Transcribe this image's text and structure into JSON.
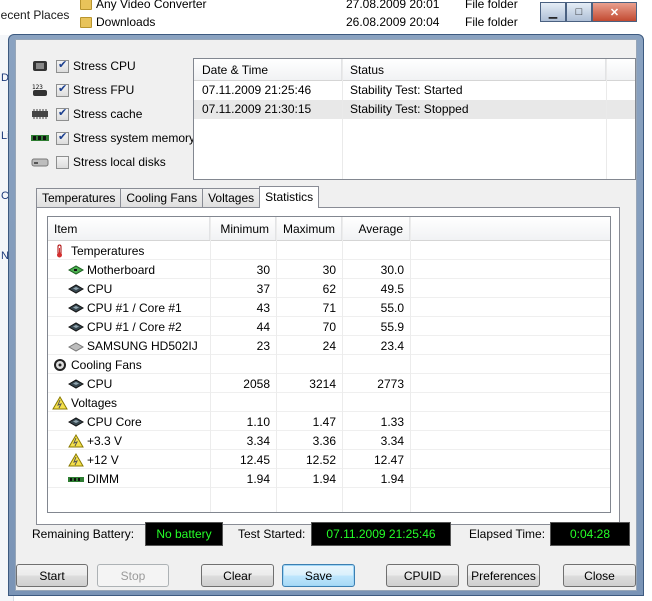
{
  "background_explorer": {
    "nav_label": "Recent Places",
    "side_fragments": [
      "D",
      "Li",
      "Co",
      "N"
    ],
    "files": [
      {
        "name": "Any Video Converter",
        "date": "27.08.2009 20:01",
        "type": "File folder"
      },
      {
        "name": "Downloads",
        "date": "26.08.2009 20:04",
        "type": "File folder"
      }
    ]
  },
  "window_controls": {
    "minimize": "▁",
    "maximize": "□",
    "close": "✕"
  },
  "stress_options": [
    {
      "label": "Stress CPU",
      "checked": true,
      "icon": "cpu-icon"
    },
    {
      "label": "Stress FPU",
      "checked": true,
      "icon": "fpu-icon"
    },
    {
      "label": "Stress cache",
      "checked": true,
      "icon": "cache-icon"
    },
    {
      "label": "Stress system memory",
      "checked": true,
      "icon": "memory-icon"
    },
    {
      "label": "Stress local disks",
      "checked": false,
      "icon": "disk-icon"
    }
  ],
  "status_log": {
    "headers": [
      "Date & Time",
      "Status"
    ],
    "rows": [
      {
        "datetime": "07.11.2009 21:25:46",
        "status": "Stability Test: Started"
      },
      {
        "datetime": "07.11.2009 21:30:15",
        "status": "Stability Test: Stopped"
      }
    ]
  },
  "tabs": [
    "Temperatures",
    "Cooling Fans",
    "Voltages",
    "Statistics"
  ],
  "active_tab": "Statistics",
  "statistics": {
    "headers": [
      "Item",
      "Minimum",
      "Maximum",
      "Average"
    ],
    "rows": [
      {
        "group": true,
        "item": "Temperatures",
        "icon": "thermometer-icon",
        "min": "",
        "max": "",
        "avg": ""
      },
      {
        "group": false,
        "item": "Motherboard",
        "icon": "motherboard-icon",
        "min": "30",
        "max": "30",
        "avg": "30.0"
      },
      {
        "group": false,
        "item": "CPU",
        "icon": "cpu-chip-icon",
        "min": "37",
        "max": "62",
        "avg": "49.5"
      },
      {
        "group": false,
        "item": "CPU #1 / Core #1",
        "icon": "cpu-chip-icon",
        "min": "43",
        "max": "71",
        "avg": "55.0"
      },
      {
        "group": false,
        "item": "CPU #1 / Core #2",
        "icon": "cpu-chip-icon",
        "min": "44",
        "max": "70",
        "avg": "55.9"
      },
      {
        "group": false,
        "item": "SAMSUNG HD502IJ",
        "icon": "hard-disk-icon",
        "min": "23",
        "max": "24",
        "avg": "23.4"
      },
      {
        "group": true,
        "item": "Cooling Fans",
        "icon": "fan-icon",
        "min": "",
        "max": "",
        "avg": ""
      },
      {
        "group": false,
        "item": "CPU",
        "icon": "cpu-chip-icon",
        "min": "2058",
        "max": "3214",
        "avg": "2773"
      },
      {
        "group": true,
        "item": "Voltages",
        "icon": "voltage-icon",
        "min": "",
        "max": "",
        "avg": ""
      },
      {
        "group": false,
        "item": "CPU Core",
        "icon": "cpu-chip-icon",
        "min": "1.10",
        "max": "1.47",
        "avg": "1.33"
      },
      {
        "group": false,
        "item": "+3.3 V",
        "icon": "voltage-icon",
        "min": "3.34",
        "max": "3.36",
        "avg": "3.34"
      },
      {
        "group": false,
        "item": "+12 V",
        "icon": "voltage-icon",
        "min": "12.45",
        "max": "12.52",
        "avg": "12.47"
      },
      {
        "group": false,
        "item": "DIMM",
        "icon": "memory-icon",
        "min": "1.94",
        "max": "1.94",
        "avg": "1.94"
      }
    ]
  },
  "footer": {
    "battery_label": "Remaining Battery:",
    "battery_value": "No battery",
    "started_label": "Test Started:",
    "started_value": "07.11.2009 21:25:46",
    "elapsed_label": "Elapsed Time:",
    "elapsed_value": "0:04:28"
  },
  "buttons": {
    "start": "Start",
    "stop": "Stop",
    "clear": "Clear",
    "save": "Save",
    "cpuid": "CPUID",
    "preferences": "Preferences",
    "close": "Close"
  },
  "colors": {
    "led_text": "#25ff28",
    "led_bg": "#000000"
  }
}
